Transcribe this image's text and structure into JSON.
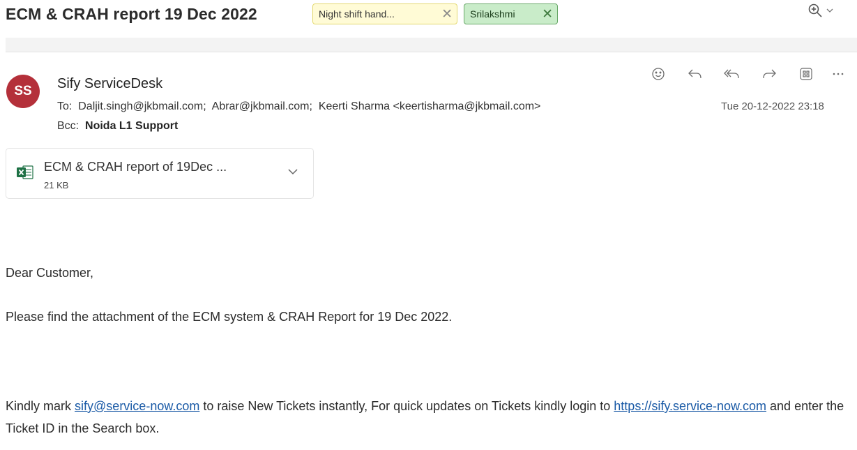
{
  "header": {
    "subject": "ECM & CRAH report 19 Dec 2022",
    "tags": [
      {
        "label": "Night shift hand...",
        "color": "#fffbd6"
      },
      {
        "label": "Srilakshmi",
        "color": "#c9ecc9"
      }
    ],
    "zoom_icon": "zoom-in-icon"
  },
  "message": {
    "avatar_initials": "SS",
    "avatar_color": "#b4303a",
    "sender": "Sify ServiceDesk",
    "to_label": "To:",
    "to": "Daljit.singh@jkbmail.com;  Abrar@jkbmail.com;  Keerti Sharma <keertisharma@jkbmail.com>",
    "bcc_label": "Bcc:",
    "bcc": "Noida L1 Support",
    "date": "Tue 20-12-2022 23:18",
    "actions": [
      "emoji-icon",
      "reply-icon",
      "reply-all-icon",
      "forward-icon",
      "apps-icon",
      "more-icon"
    ]
  },
  "attachment": {
    "name": "ECM & CRAH report of 19Dec ...",
    "size": "21 KB",
    "type_icon": "excel-file-icon"
  },
  "body": {
    "greeting": "Dear Customer,",
    "para1": "Please find the attachment of the ECM system & CRAH Report for 19 Dec 2022.",
    "para2_prefix": "Kindly mark ",
    "email_link": "sify@service-now.com",
    "para2_middle": " to raise New Tickets instantly, For quick updates on Tickets kindly login to ",
    "url_link": "https://sify.service-now.com",
    "para2_suffix": " and enter the Ticket ID in the Search box."
  }
}
